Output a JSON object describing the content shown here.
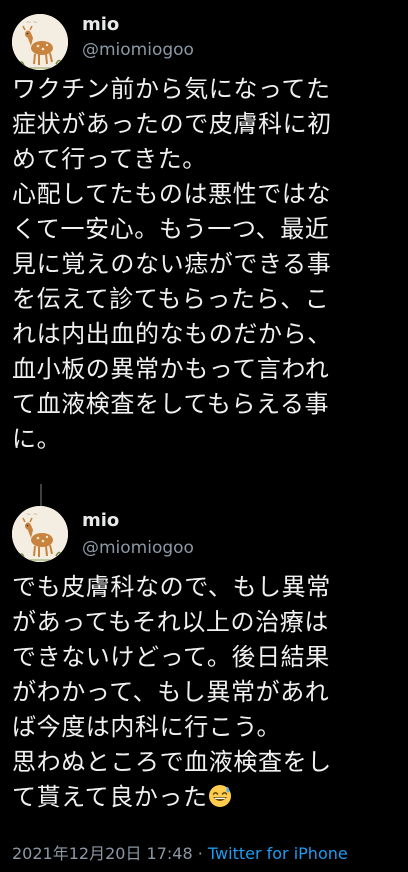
{
  "tweets": [
    {
      "name": "mio",
      "handle": "@miomiogoo",
      "lines": [
        "ワクチン前から気になってた",
        "症状があったので皮膚科に初",
        "めて行ってきた。",
        "心配してたものは悪性ではな",
        "くて一安心。もう一つ、最近",
        "見に覚えのない痣ができる事",
        "を伝えて診てもらったら、こ",
        "れは内出血的なものだから、",
        "血小板の異常かもって言われ",
        "て血液検査をしてもらえる事",
        "に。"
      ]
    },
    {
      "name": "mio",
      "handle": "@miomiogoo",
      "lines": [
        "でも皮膚科なので、もし異常",
        "があってもそれ以上の治療は",
        "できないけどって。後日結果",
        "がわかって、もし異常があれ",
        "ば今度は内科に行こう。",
        "思わぬところで血液検査をし",
        "て貰えて良かった"
      ],
      "emoji": "grinning-sweat-emoji",
      "timestamp": "2021年12月20日 17:48",
      "separator": " · ",
      "client": "Twitter for iPhone"
    }
  ],
  "colors": {
    "background": "#000000",
    "text": "#e7e9ea",
    "secondary": "#8b98a5",
    "link": "#1d9bf0"
  }
}
